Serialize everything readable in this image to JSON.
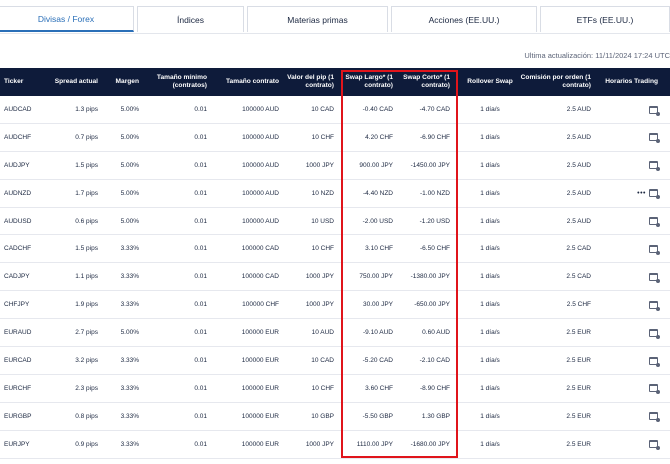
{
  "tabs": [
    {
      "label": "Divisas / Forex",
      "active": true
    },
    {
      "label": "Índices",
      "active": false
    },
    {
      "label": "Materias primas",
      "active": false
    },
    {
      "label": "Acciones (EE.UU.)",
      "active": false
    },
    {
      "label": "ETFs (EE.UU.)",
      "active": false
    }
  ],
  "updated": "Ultima actualización: 11/11/2024 17:24 UTC",
  "headers": {
    "ticker": "Ticker",
    "spread": "Spread actual",
    "margen": "Margen",
    "tam_min": "Tamaño mínimo (contratos)",
    "tam_contrato": "Tamaño contrato",
    "valor_pip": "Valor del pip (1 contrato)",
    "swap_largo": "Swap Largo* (1 contrato)",
    "swap_corto": "Swap Corto* (1 contrato)",
    "rollover": "Rollover Swap",
    "comision": "Comisión por orden (1 contrato)",
    "horarios": "Horarios Trading"
  },
  "rows": [
    {
      "ticker": "AUDCAD",
      "spread": "1.3 pips",
      "margen": "5.00%",
      "min": "0.01",
      "contrato": "100000 AUD",
      "pip": "10 CAD",
      "largo": "-0.40 CAD",
      "corto": "-4.70 CAD",
      "rollover": "1 día/s",
      "comision": "2.5 AUD",
      "dots": ""
    },
    {
      "ticker": "AUDCHF",
      "spread": "0.7 pips",
      "margen": "5.00%",
      "min": "0.01",
      "contrato": "100000 AUD",
      "pip": "10 CHF",
      "largo": "4.20 CHF",
      "corto": "-6.90 CHF",
      "rollover": "1 día/s",
      "comision": "2.5 AUD",
      "dots": ""
    },
    {
      "ticker": "AUDJPY",
      "spread": "1.5 pips",
      "margen": "5.00%",
      "min": "0.01",
      "contrato": "100000 AUD",
      "pip": "1000 JPY",
      "largo": "900.00 JPY",
      "corto": "-1450.00 JPY",
      "rollover": "1 día/s",
      "comision": "2.5 AUD",
      "dots": ""
    },
    {
      "ticker": "AUDNZD",
      "spread": "1.7 pips",
      "margen": "5.00%",
      "min": "0.01",
      "contrato": "100000 AUD",
      "pip": "10 NZD",
      "largo": "-4.40 NZD",
      "corto": "-1.00 NZD",
      "rollover": "1 día/s",
      "comision": "2.5 AUD",
      "dots": "•••"
    },
    {
      "ticker": "AUDUSD",
      "spread": "0.6 pips",
      "margen": "5.00%",
      "min": "0.01",
      "contrato": "100000 AUD",
      "pip": "10 USD",
      "largo": "-2.00 USD",
      "corto": "-1.20 USD",
      "rollover": "1 día/s",
      "comision": "2.5 AUD",
      "dots": ""
    },
    {
      "ticker": "CADCHF",
      "spread": "1.5 pips",
      "margen": "3.33%",
      "min": "0.01",
      "contrato": "100000 CAD",
      "pip": "10 CHF",
      "largo": "3.10 CHF",
      "corto": "-6.50 CHF",
      "rollover": "1 día/s",
      "comision": "2.5 CAD",
      "dots": ""
    },
    {
      "ticker": "CADJPY",
      "spread": "1.1 pips",
      "margen": "3.33%",
      "min": "0.01",
      "contrato": "100000 CAD",
      "pip": "1000 JPY",
      "largo": "750.00 JPY",
      "corto": "-1380.00 JPY",
      "rollover": "1 día/s",
      "comision": "2.5 CAD",
      "dots": ""
    },
    {
      "ticker": "CHFJPY",
      "spread": "1.9 pips",
      "margen": "3.33%",
      "min": "0.01",
      "contrato": "100000 CHF",
      "pip": "1000 JPY",
      "largo": "30.00 JPY",
      "corto": "-650.00 JPY",
      "rollover": "1 día/s",
      "comision": "2.5 CHF",
      "dots": ""
    },
    {
      "ticker": "EURAUD",
      "spread": "2.7 pips",
      "margen": "5.00%",
      "min": "0.01",
      "contrato": "100000 EUR",
      "pip": "10 AUD",
      "largo": "-9.10 AUD",
      "corto": "0.60 AUD",
      "rollover": "1 día/s",
      "comision": "2.5 EUR",
      "dots": ""
    },
    {
      "ticker": "EURCAD",
      "spread": "3.2 pips",
      "margen": "3.33%",
      "min": "0.01",
      "contrato": "100000 EUR",
      "pip": "10 CAD",
      "largo": "-5.20 CAD",
      "corto": "-2.10 CAD",
      "rollover": "1 día/s",
      "comision": "2.5 EUR",
      "dots": ""
    },
    {
      "ticker": "EURCHF",
      "spread": "2.3 pips",
      "margen": "3.33%",
      "min": "0.01",
      "contrato": "100000 EUR",
      "pip": "10 CHF",
      "largo": "3.60 CHF",
      "corto": "-8.90 CHF",
      "rollover": "1 día/s",
      "comision": "2.5 EUR",
      "dots": ""
    },
    {
      "ticker": "EURGBP",
      "spread": "0.8 pips",
      "margen": "3.33%",
      "min": "0.01",
      "contrato": "100000 EUR",
      "pip": "10 GBP",
      "largo": "-5.50 GBP",
      "corto": "1.30 GBP",
      "rollover": "1 día/s",
      "comision": "2.5 EUR",
      "dots": ""
    },
    {
      "ticker": "EURJPY",
      "spread": "0.9 pips",
      "margen": "3.33%",
      "min": "0.01",
      "contrato": "100000 EUR",
      "pip": "1000 JPY",
      "largo": "1110.00 JPY",
      "corto": "-1680.00 JPY",
      "rollover": "1 día/s",
      "comision": "2.5 EUR",
      "dots": ""
    }
  ],
  "colors": {
    "header_bg": "#0e1b3a",
    "accent": "#2a6fb8",
    "highlight": "#e0141b"
  },
  "icons": {
    "schedule": "calendar-clock-icon",
    "more": "ellipsis-icon"
  }
}
